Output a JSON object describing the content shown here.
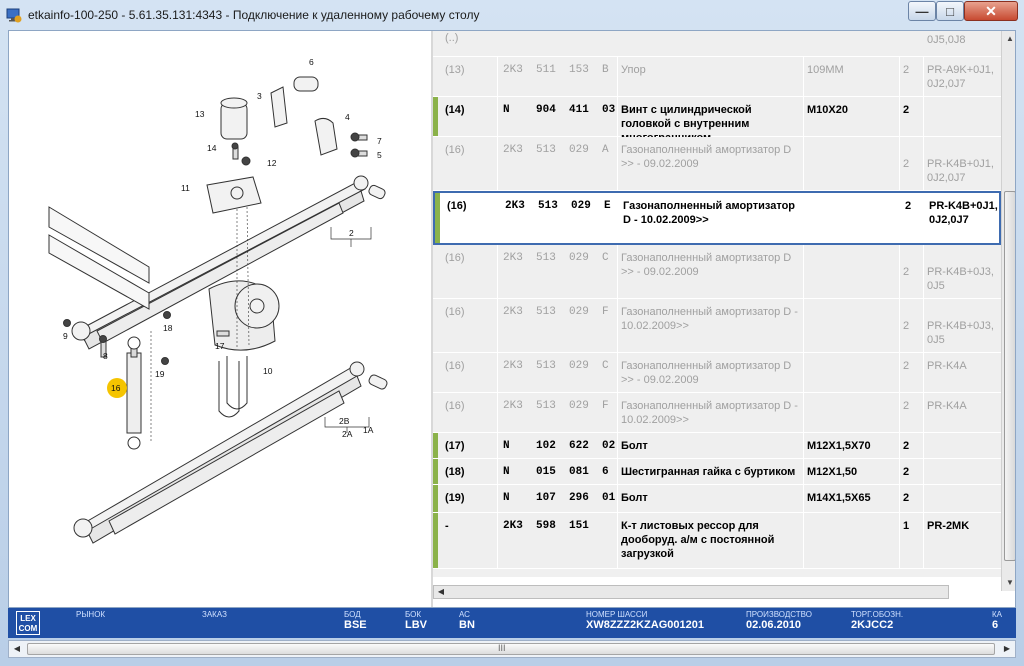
{
  "window": {
    "title": "etkainfo-100-250 - 5.61.35.131:4343 - Подключение к удаленному рабочему столу",
    "min_label": "—",
    "max_label": "□",
    "close_label": "✕"
  },
  "illustration": {
    "callouts": [
      "1A",
      "2",
      "2A",
      "2B",
      "3",
      "4",
      "5",
      "6",
      "7",
      "8",
      "9",
      "10",
      "11",
      "12",
      "13",
      "14",
      "16",
      "17",
      "18",
      "19"
    ],
    "highlight": "16"
  },
  "parts": [
    {
      "pos": "(13)",
      "part": "2K3  511  153  B",
      "desc": "Упор",
      "note": "109MM",
      "qty": "2",
      "model": "PR-A9K+0J1, 0J2,0J7",
      "state": "inactive"
    },
    {
      "pos": "(14)",
      "part": "N    904  411  03",
      "desc": "Винт с цилиндрической головкой с внутренним многогранником",
      "note": "M10X20",
      "qty": "2",
      "model": "",
      "state": "active"
    },
    {
      "pos": "(16)",
      "part": "2K3  513  029  A",
      "desc": "Газонаполненный амортизатор D               >> - 09.02.2009",
      "note": "",
      "qty": "2",
      "model": "PR-K4B+0J1, 0J2,0J7",
      "state": "inactive"
    },
    {
      "pos": "(16)",
      "part": "2K3  513  029  E",
      "desc": "Газонаполненный амортизатор D - 10.02.2009>>",
      "note": "",
      "qty": "2",
      "model": "PR-K4B+0J1, 0J2,0J7",
      "state": "selected"
    },
    {
      "pos": "(16)",
      "part": "2K3  513  029  C",
      "desc": "Газонаполненный амортизатор D               >> - 09.02.2009",
      "note": "",
      "qty": "2",
      "model": "PR-K4B+0J3, 0J5",
      "state": "inactive"
    },
    {
      "pos": "(16)",
      "part": "2K3  513  029  F",
      "desc": "Газонаполненный амортизатор D - 10.02.2009>>",
      "note": "",
      "qty": "2",
      "model": "PR-K4B+0J3, 0J5",
      "state": "inactive"
    },
    {
      "pos": "(16)",
      "part": "2K3  513  029  C",
      "desc": "Газонаполненный амортизатор D               >> - 09.02.2009",
      "note": "",
      "qty": "2",
      "model": "PR-K4A",
      "state": "inactive"
    },
    {
      "pos": "(16)",
      "part": "2K3  513  029  F",
      "desc": "Газонаполненный амортизатор D - 10.02.2009>>",
      "note": "",
      "qty": "2",
      "model": "PR-K4A",
      "state": "inactive"
    },
    {
      "pos": "(17)",
      "part": "N    102  622  02",
      "desc": "Болт",
      "note": "M12X1,5X70",
      "qty": "2",
      "model": "",
      "state": "active"
    },
    {
      "pos": "(18)",
      "part": "N    015  081  6",
      "desc": "Шестигранная гайка с буртиком",
      "note": "M12X1,50",
      "qty": "2",
      "model": "",
      "state": "active"
    },
    {
      "pos": "(19)",
      "part": "N    107  296  01",
      "desc": "Болт",
      "note": "M14X1,5X65",
      "qty": "2",
      "model": "",
      "state": "active"
    },
    {
      "pos": "-",
      "part": "2K3  598  151",
      "desc": "К-т листовых рессор для дооборуд. а/м с постоянной загрузкой",
      "note": "",
      "qty": "1",
      "model": "PR-2MK",
      "state": "active"
    }
  ],
  "top_partial": {
    "pos": "(..)",
    "model": "0J5,0J8"
  },
  "status": {
    "logo": "LEX COM",
    "fields": [
      {
        "label": "РЫНОК",
        "value": ""
      },
      {
        "label": "ЗАКАЗ",
        "value": ""
      },
      {
        "label": "БОД",
        "value": "BSE"
      },
      {
        "label": "БОК",
        "value": "LBV"
      },
      {
        "label": "АС",
        "value": "BN"
      },
      {
        "label": "НОМЕР ШАССИ",
        "value": "XW8ZZZ2KZAG001201"
      },
      {
        "label": "ПРОИЗВОДСТВО",
        "value": "02.06.2010"
      },
      {
        "label": "ТОРГ.ОБОЗН.",
        "value": "2KJCC2"
      },
      {
        "label": "КА",
        "value": "6"
      }
    ]
  },
  "colors": {
    "status_bg": "#1f4fa5",
    "row_marker": "#8bb24a",
    "selected_border": "#3e6bb0",
    "highlight_callout": "#f5c400"
  },
  "bottom_scroll_label": "III"
}
